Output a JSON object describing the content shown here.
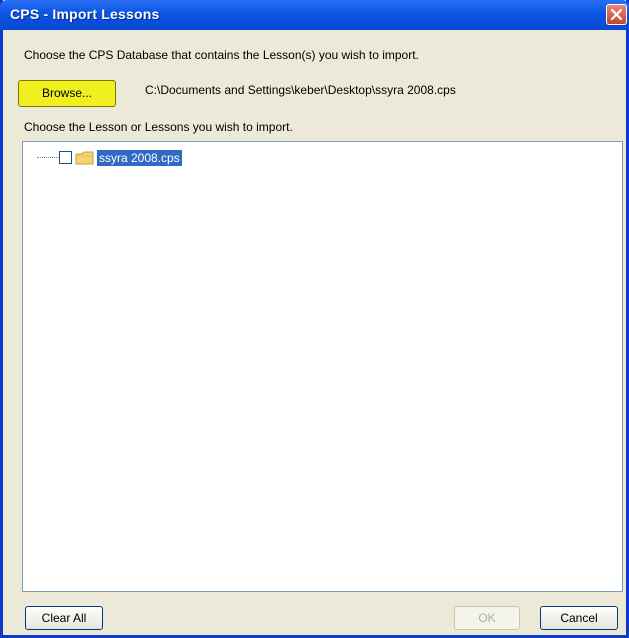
{
  "window": {
    "title": "CPS - Import Lessons"
  },
  "database": {
    "prompt": "Choose the CPS Database that contains the Lesson(s) you wish to import.",
    "browse_label": "Browse...",
    "path": "C:\\Documents and Settings\\keber\\Desktop\\ssyra 2008.cps"
  },
  "lessons": {
    "prompt": "Choose the Lesson or Lessons you wish to import.",
    "tree": [
      {
        "label": "ssyra 2008.cps",
        "checked": false,
        "selected": true
      }
    ]
  },
  "footer": {
    "clear_all_label": "Clear All",
    "ok_label": "OK",
    "cancel_label": "Cancel"
  },
  "colors": {
    "titlebar": "#0a55e3",
    "highlight": "#316ac5",
    "browse_bg": "#f0f020"
  },
  "icons": {
    "close": "close-icon",
    "folder": "folder-icon"
  }
}
